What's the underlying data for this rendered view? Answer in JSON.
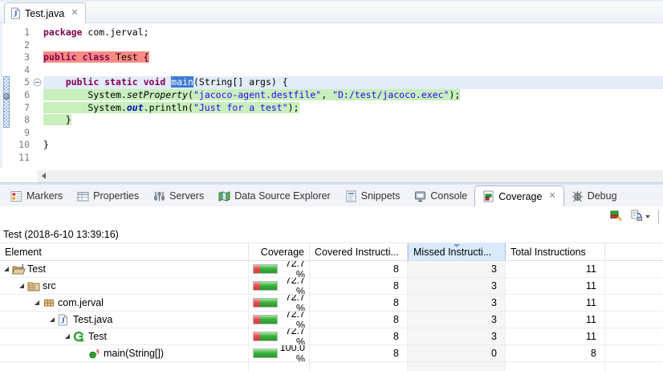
{
  "colors": {
    "covered_green": "#2ea12e",
    "missed_red": "#d84444",
    "line_covered_bg": "#c8f0bd",
    "line_missed_bg": "#f98b84",
    "selection_blue": "#3d7bd6",
    "sorted_header_bg": "#d9eafc"
  },
  "editor": {
    "tab": {
      "title": "Test.java",
      "icon": "java-file",
      "close_glyph": "✕"
    },
    "lines": [
      {
        "n": "1",
        "segs": [
          {
            "t": "package ",
            "c": "kw"
          },
          {
            "t": "com.jerval;",
            "c": "pl"
          }
        ]
      },
      {
        "n": "2",
        "segs": []
      },
      {
        "n": "3",
        "hl": "red",
        "segs": [
          {
            "t": "public class ",
            "c": "kw"
          },
          {
            "t": "Test {",
            "c": "pl"
          }
        ]
      },
      {
        "n": "4",
        "segs": []
      },
      {
        "n": "5",
        "cur": true,
        "fold": "minus",
        "segs": [
          {
            "t": "    ",
            "c": "pl"
          },
          {
            "t": "public static void ",
            "c": "kw"
          },
          {
            "t": "main",
            "c": "sel"
          },
          {
            "t": "(String[] args) {",
            "c": "pl"
          }
        ]
      },
      {
        "n": "6",
        "hl": "green",
        "marker": "breakpoint",
        "segs": [
          {
            "t": "        System.",
            "c": "pl"
          },
          {
            "t": "setProperty",
            "c": "sm"
          },
          {
            "t": "(",
            "c": "pl"
          },
          {
            "t": "\"jacoco-agent.destfile\"",
            "c": "str"
          },
          {
            "t": ", ",
            "c": "pl"
          },
          {
            "t": "\"D:/test/jacoco.exec\"",
            "c": "str"
          },
          {
            "t": ");",
            "c": "pl"
          }
        ]
      },
      {
        "n": "7",
        "hl": "green",
        "segs": [
          {
            "t": "        System.",
            "c": "pl"
          },
          {
            "t": "out",
            "c": "sf"
          },
          {
            "t": ".println(",
            "c": "pl"
          },
          {
            "t": "\"Just for a test\"",
            "c": "str"
          },
          {
            "t": ");",
            "c": "pl"
          }
        ]
      },
      {
        "n": "8",
        "hl": "green",
        "segs": [
          {
            "t": "    }",
            "c": "pl"
          }
        ]
      },
      {
        "n": "9",
        "segs": []
      },
      {
        "n": "10",
        "segs": [
          {
            "t": "}",
            "c": "pl"
          }
        ]
      },
      {
        "n": "11",
        "segs": []
      }
    ]
  },
  "panel": {
    "tabs": [
      {
        "label": "Markers",
        "icon": "markers"
      },
      {
        "label": "Properties",
        "icon": "properties"
      },
      {
        "label": "Servers",
        "icon": "servers"
      },
      {
        "label": "Data Source Explorer",
        "icon": "data-source"
      },
      {
        "label": "Snippets",
        "icon": "snippets"
      },
      {
        "label": "Console",
        "icon": "console"
      },
      {
        "label": "Coverage",
        "icon": "coverage",
        "active": true,
        "closable": true,
        "close_glyph": "✕"
      },
      {
        "label": "Debug",
        "icon": "debug"
      }
    ],
    "toolbar": {
      "icons": [
        {
          "name": "coverage-session"
        },
        {
          "name": "export-session",
          "dropdown": true
        }
      ]
    },
    "session_label": "Test (2018-6-10 13:39:16)",
    "table": {
      "columns": [
        {
          "label": "Element"
        },
        {
          "label": "Coverage"
        },
        {
          "label": "Covered Instructi..."
        },
        {
          "label": "Missed Instructi...",
          "sorted": true
        },
        {
          "label": "Total Instructions"
        }
      ],
      "rows": [
        {
          "label": "Test",
          "icon": "project",
          "level": 0,
          "expanded": true,
          "coverage_pct": 72.7,
          "coverage_label": "72.7 %",
          "covered": "8",
          "missed": "3",
          "total": "11"
        },
        {
          "label": "src",
          "icon": "source-folder",
          "level": 1,
          "expanded": true,
          "coverage_pct": 72.7,
          "coverage_label": "72.7 %",
          "covered": "8",
          "missed": "3",
          "total": "11"
        },
        {
          "label": "com.jerval",
          "icon": "package",
          "level": 2,
          "expanded": true,
          "coverage_pct": 72.7,
          "coverage_label": "72.7 %",
          "covered": "8",
          "missed": "3",
          "total": "11"
        },
        {
          "label": "Test.java",
          "icon": "java-file",
          "level": 3,
          "expanded": true,
          "coverage_pct": 72.7,
          "coverage_label": "72.7 %",
          "covered": "8",
          "missed": "3",
          "total": "11"
        },
        {
          "label": "Test",
          "icon": "class",
          "level": 4,
          "expanded": true,
          "coverage_pct": 72.7,
          "coverage_label": "72.7 %",
          "covered": "8",
          "missed": "3",
          "total": "11"
        },
        {
          "label": "main(String[])",
          "icon": "static-method",
          "level": 5,
          "expanded": false,
          "coverage_pct": 100.0,
          "coverage_label": "100.0 %",
          "covered": "8",
          "missed": "0",
          "total": "8"
        }
      ]
    }
  }
}
